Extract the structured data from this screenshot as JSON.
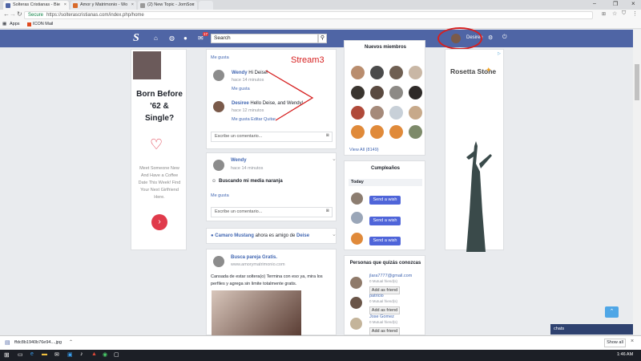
{
  "browser": {
    "tabs": [
      {
        "label": "Solteras Cristianas - Bie"
      },
      {
        "label": "Amor y Matrimonio - Wo"
      },
      {
        "label": "(2) New Topic - JomSoc"
      },
      {
        "label": ""
      }
    ],
    "secure_label": "Secure",
    "url": "https://solterascristianas.com/index.php/home",
    "bookmarks": [
      {
        "label": "Apps"
      },
      {
        "label": "ICON Mail"
      }
    ]
  },
  "site": {
    "logo": "S",
    "notification_count": "17",
    "search_placeholder": "Search",
    "user_name": "Desiree"
  },
  "annotation": {
    "text": "Stream3"
  },
  "ad_left": {
    "headline": "Born Before '62 & Single?",
    "body": "Meet Someone New And Have a Coffee Date This Week! Find Your Next Girlfriend Here."
  },
  "stream": {
    "top_like": "Me gusta",
    "comments": [
      {
        "name": "Wendy",
        "text": "Hi Deise!",
        "time": "hace 14 minutos",
        "actions": "Me gusta"
      },
      {
        "name": "Desiree",
        "text": "Hello Deise, and Wendy!",
        "time": "hace 12 minutos",
        "actions": "Me gusta Editar Quitar"
      }
    ],
    "comment_placeholder": "Escribe un comentario...",
    "post2": {
      "author": "Wendy",
      "time": "hace 14 minutos",
      "text": "Buscando mi media naranja",
      "like": "Me gusta"
    },
    "friends_line": {
      "name1": "Camaro Mustang",
      "middle": "ahora es amigo de",
      "name2": "Deise"
    },
    "post3": {
      "title": "Busca pareja Gratis.",
      "site": "www.amorymatrimonio.com",
      "text": "Cansada de estar soltera(o) Termina con eso ya, mira los perfiles y agrega sin limite totalmente gratis."
    }
  },
  "members": {
    "title": "Nuevos miembros",
    "view_all": "View All (8149)"
  },
  "birthdays": {
    "title": "Cumpleaños",
    "today": "Today",
    "button": "Send a wish"
  },
  "suggestions": {
    "title": "Personas que quizás conozcas",
    "people": [
      {
        "name": "jlara7777@gmail.com",
        "mutual": "0 Mutual friend(s)",
        "button": "Add as friend"
      },
      {
        "name": "patricio",
        "mutual": "0 Mutual friend(s)",
        "button": "Add as friend"
      },
      {
        "name": "Jose Gomez",
        "mutual": "0 Mutual friend(s)",
        "button": "Add as friend"
      }
    ]
  },
  "ad_right": {
    "brand": "Rosetta Stone"
  },
  "chat": {
    "label": "chats"
  },
  "download": {
    "file": "ffdc8b1940b76e94....jpg",
    "show_all": "Show all"
  },
  "taskbar": {
    "time": "1:46 AM"
  }
}
